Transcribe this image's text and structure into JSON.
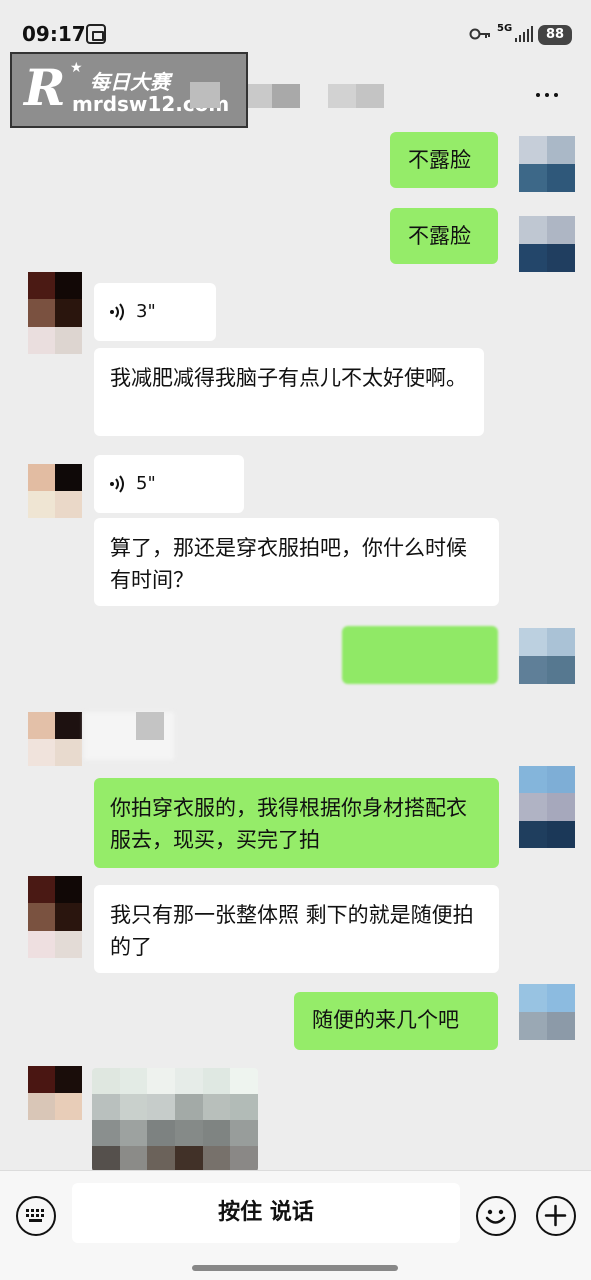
{
  "status_bar": {
    "time": "09:17",
    "network": "5G",
    "battery": "88",
    "icons": [
      "screen-record-icon",
      "key-icon",
      "signal-icon",
      "battery-icon"
    ]
  },
  "watermark": {
    "logo_letter": "R",
    "name": "每日大赛",
    "url": "mrdsw12.com"
  },
  "header": {
    "more_icon": "more-icon"
  },
  "messages": [
    {
      "side": "out",
      "type": "text",
      "text": "不露脸"
    },
    {
      "side": "out",
      "type": "text",
      "text": "不露脸"
    },
    {
      "side": "in",
      "type": "voice",
      "duration": "3\""
    },
    {
      "side": "in",
      "type": "text",
      "text": "我减肥减得我脑子有点儿不太好使啊。"
    },
    {
      "side": "in",
      "type": "voice",
      "duration": "5\""
    },
    {
      "side": "in",
      "type": "text",
      "text": "算了，那还是穿衣服拍吧，你什么时候有时间？"
    },
    {
      "side": "out",
      "type": "blurred"
    },
    {
      "side": "in",
      "type": "blurred"
    },
    {
      "side": "out",
      "type": "text",
      "text": "你拍穿衣服的，我得根据你身材搭配衣服去，现买，买完了拍"
    },
    {
      "side": "in",
      "type": "text",
      "text": "我只有那一张整体照 剩下的就是随便拍的了"
    },
    {
      "side": "out",
      "type": "text",
      "text": "随便的来几个吧"
    },
    {
      "side": "in",
      "type": "image"
    }
  ],
  "bottom_bar": {
    "hold_to_talk": "按住 说话",
    "icons": [
      "keyboard-icon",
      "emoji-icon",
      "plus-icon"
    ]
  },
  "colors": {
    "background": "#ededed",
    "out_bubble": "#95ec69",
    "in_bubble": "#ffffff"
  }
}
